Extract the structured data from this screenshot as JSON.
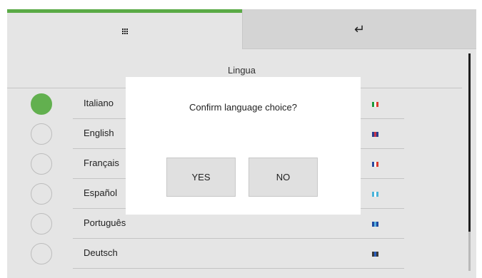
{
  "header": {
    "tabs": [
      {
        "icon": "grid-menu-icon",
        "active": true,
        "accent": "#5aaa46"
      },
      {
        "icon": "return-arrow-icon",
        "active": false,
        "glyph": "↵"
      }
    ]
  },
  "title": "Lingua",
  "languages": [
    {
      "label": "Italiano",
      "selected": true,
      "flag_colors": [
        "#1a9a3a",
        "#ffffff",
        "#d93a2e"
      ]
    },
    {
      "label": "English",
      "selected": false,
      "flag_colors": [
        "#2a3d8f",
        "#c9374a",
        "#2a3d8f"
      ]
    },
    {
      "label": "Français",
      "selected": false,
      "flag_colors": [
        "#2a4aa0",
        "#ffffff",
        "#d93a2e"
      ]
    },
    {
      "label": "Español",
      "selected": false,
      "flag_colors": [
        "#4ab4d9",
        "#ffffff",
        "#4ab4d9"
      ]
    },
    {
      "label": "Português",
      "selected": false,
      "flag_colors": [
        "#1f4aa0",
        "#5ab0e0",
        "#1f4aa0"
      ]
    },
    {
      "label": "Deutsch",
      "selected": false,
      "flag_colors": [
        "#3a3a3a",
        "#2a60c0",
        "#3a3a3a"
      ]
    }
  ],
  "dialog": {
    "message": "Confirm language choice?",
    "yes_label": "YES",
    "no_label": "NO"
  },
  "colors": {
    "selected": "#62b04f",
    "background": "#e5e5e5"
  }
}
